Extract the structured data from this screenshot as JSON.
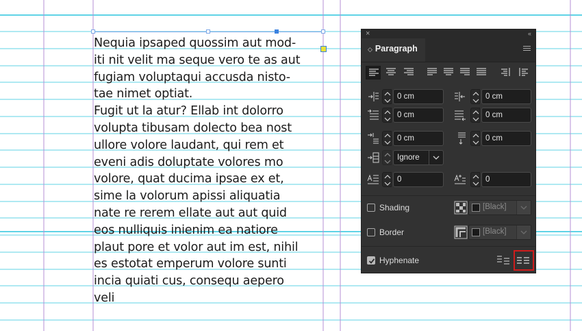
{
  "document": {
    "story_lines": [
      "Nequia ipsaped quossim aut mod-",
      "iti nit velit ma seque vero te as aut",
      "fugiam voluptaqui accusda nisto-",
      "tae nimet optiat.",
      "Fugit ut la atur? Ellab int dolorro",
      "volupta tibusam dolecto bea nost",
      "ullore volore laudant, qui rem et",
      "eveni adis doluptate volores mo",
      "volore, quat ducima ipsae ex et,",
      "sime la volorum apissi aliquatia",
      "nate re rerem ellate aut aut quid",
      "eos nulliquis inienim ea natiore",
      "plaut pore et volor aut im est, nihil",
      "es estotat emperum volore sunti",
      "incia quiati cus, consequ aepero",
      "veli"
    ],
    "colors": {
      "guide": "#5fd3e6",
      "margin": "#b48fd6",
      "selection": "#3b82e0"
    }
  },
  "panel": {
    "close_glyph": "×",
    "collapse_glyph": "‹‹",
    "tab": {
      "label": "Paragraph",
      "chevron": "◇"
    },
    "left_indent": "0 cm",
    "right_indent": "0 cm",
    "first_line_indent": "0 cm",
    "last_line_indent": "0 cm",
    "space_before": "0 cm",
    "space_after": "0 cm",
    "align_to_grid": "Ignore",
    "drop_cap_lines": "0",
    "drop_cap_chars": "0",
    "shading": {
      "label": "Shading",
      "checked": false,
      "swatch": "[Black]"
    },
    "border": {
      "label": "Border",
      "checked": false,
      "swatch": "[Black]"
    },
    "hyphenate": {
      "label": "Hyphenate",
      "checked": true
    },
    "colors": {
      "panel_bg": "#323232",
      "highlight": "#d01c1c"
    }
  }
}
